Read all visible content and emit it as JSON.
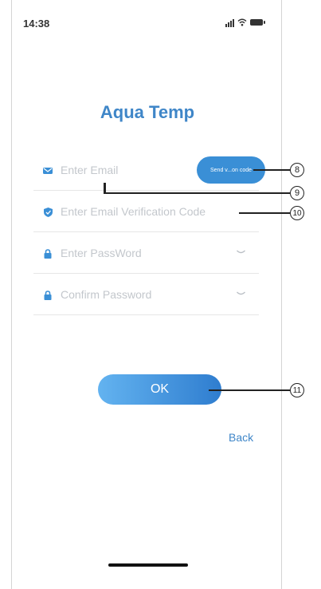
{
  "status_bar": {
    "time": "14:38"
  },
  "app": {
    "title": "Aqua Temp"
  },
  "form": {
    "email_placeholder": "Enter Email",
    "send_code_label": "Send v...on code",
    "verification_placeholder": "Enter Email Verification Code",
    "password_placeholder": "Enter PassWord",
    "confirm_placeholder": "Confirm Password"
  },
  "actions": {
    "ok_label": "OK",
    "back_label": "Back"
  },
  "callouts": [
    "8",
    "9",
    "10",
    "11"
  ],
  "colors": {
    "accent": "#3f86c8",
    "button": "#3a8fd6",
    "placeholder": "#c3c7cc"
  }
}
